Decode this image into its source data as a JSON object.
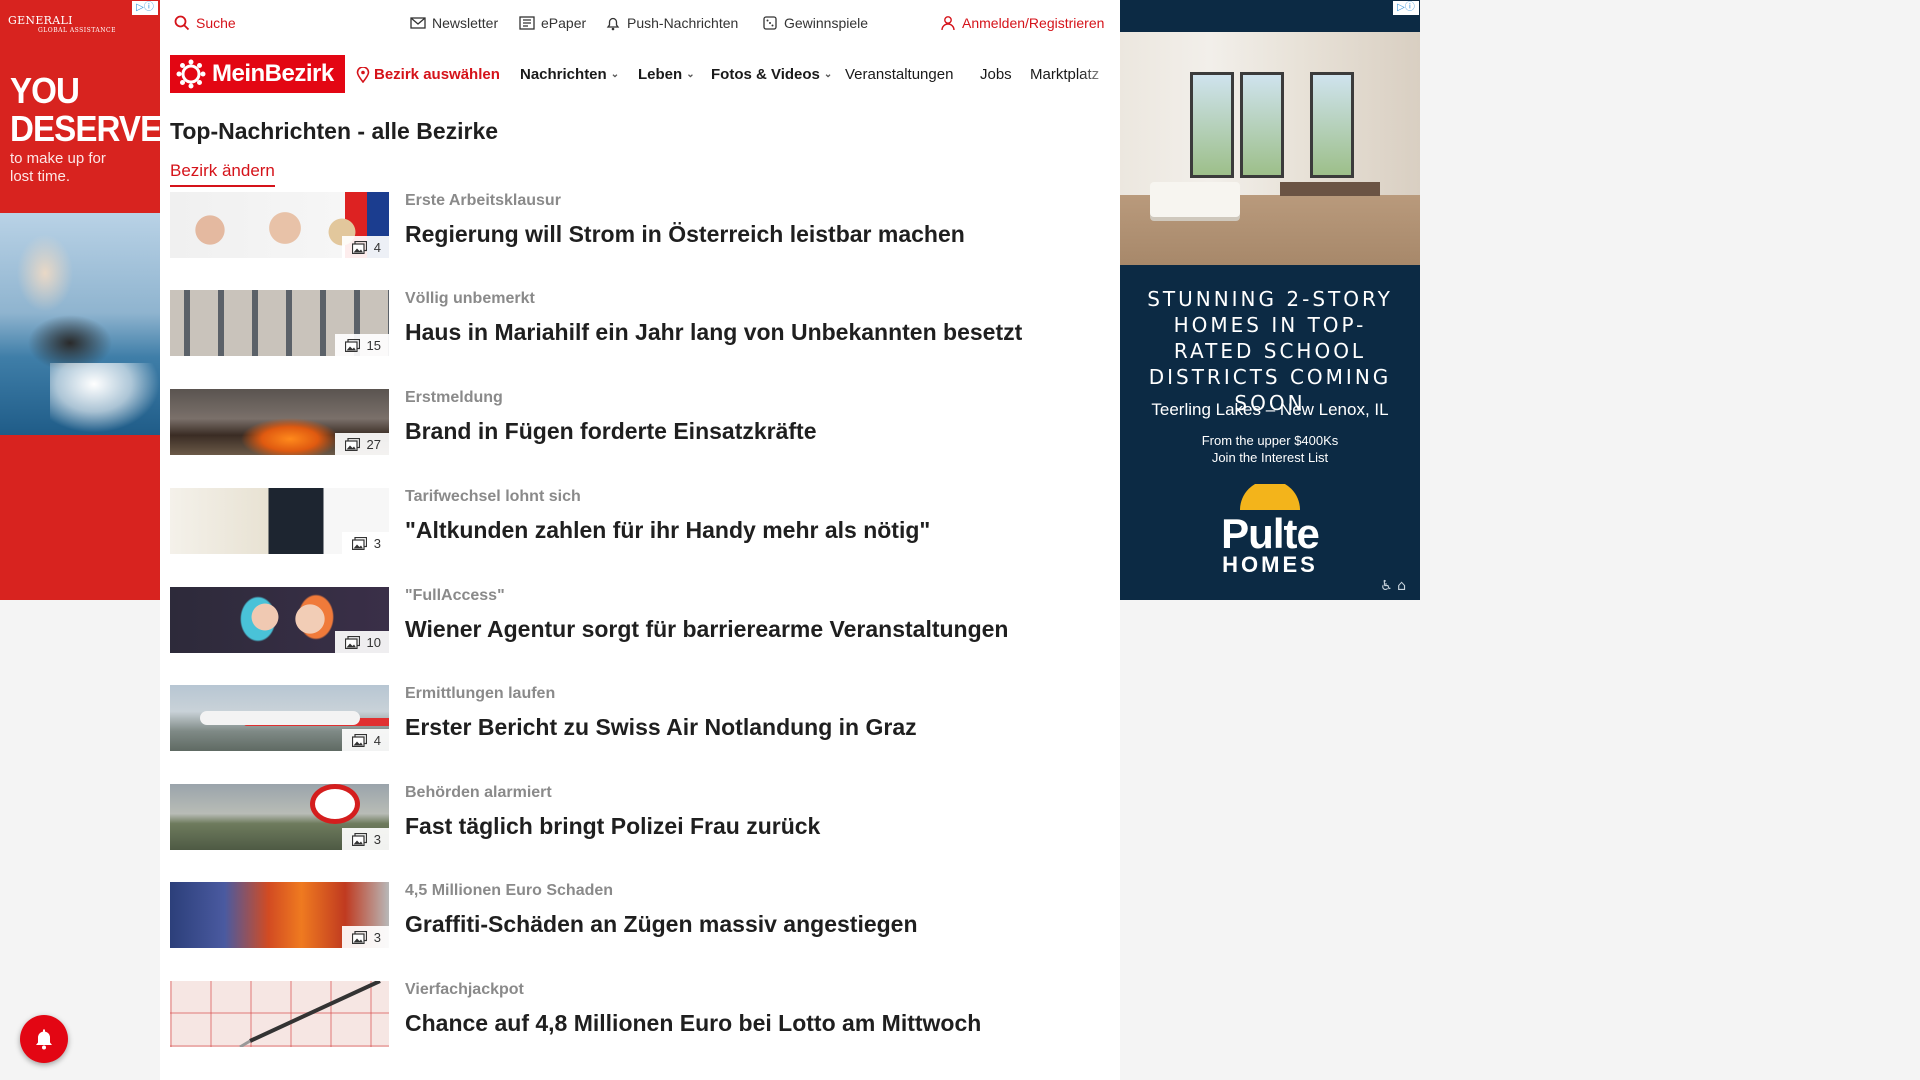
{
  "ad_left": {
    "badge": "▷ⓘ",
    "brand": "GENERALI",
    "brand_sub": "GLOBAL ASSISTANCE",
    "headline": "YOU DESERVE",
    "subline": "to make up for lost time."
  },
  "ad_right": {
    "badge": "▷ⓘ",
    "headline": "STUNNING 2-STORY HOMES IN TOP-RATED SCHOOL DISTRICTS COMING SOON",
    "location": "Teerling Lakes – New Lenox, IL",
    "price": "From the upper $400Ks",
    "cta": "Join the Interest List",
    "brand": "Pulte",
    "brand_sub": "HOMES",
    "accessibility": "♿ ⌂"
  },
  "topbar": {
    "search": "Suche",
    "newsletter": "Newsletter",
    "epaper": "ePaper",
    "push": "Push-Nachrichten",
    "games": "Gewinnspiele",
    "login": "Anmelden/Registrieren"
  },
  "nav": {
    "logo": "MeinBezirk",
    "district": "Bezirk auswählen",
    "items": [
      "Nachrichten",
      "Leben",
      "Fotos & Videos",
      "Veranstaltungen",
      "Jobs",
      "Marktplatz"
    ]
  },
  "page": {
    "title": "Top-Nachrichten - alle Bezirke",
    "change_district": "Bezirk ändern"
  },
  "articles": [
    {
      "kicker": "Erste Arbeitsklausur",
      "headline": "Regierung will Strom in Österreich leistbar machen",
      "images": "4"
    },
    {
      "kicker": "Völlig unbemerkt",
      "headline": "Haus in Mariahilf ein Jahr lang von Unbekannten besetzt",
      "images": "15"
    },
    {
      "kicker": "Erstmeldung",
      "headline": "Brand in Fügen forderte Einsatzkräfte",
      "images": "27"
    },
    {
      "kicker": "Tarifwechsel lohnt sich",
      "headline": "\"Altkunden zahlen für ihr Handy mehr als nötig\"",
      "images": "3"
    },
    {
      "kicker": "\"FullAccess\"",
      "headline": "Wiener Agentur sorgt für barrierearme Veranstaltungen",
      "images": "10"
    },
    {
      "kicker": "Ermittlungen laufen",
      "headline": "Erster Bericht zu Swiss Air Notlandung in Graz",
      "images": "4"
    },
    {
      "kicker": "Behörden alarmiert",
      "headline": "Fast täglich bringt Polizei Frau zurück",
      "images": "3"
    },
    {
      "kicker": "4,5 Millionen Euro Schaden",
      "headline": "Graffiti-Schäden an Zügen massiv angestiegen",
      "images": "3"
    },
    {
      "kicker": "Vierfachjackpot",
      "headline": "Chance auf 4,8 Millionen Euro bei Lotto am Mittwoch",
      "images": ""
    }
  ],
  "colors": {
    "brand_red": "#e30613",
    "link_red": "#d5131a",
    "ad_navy": "#0c2a44",
    "ad_red": "#d8231f"
  }
}
